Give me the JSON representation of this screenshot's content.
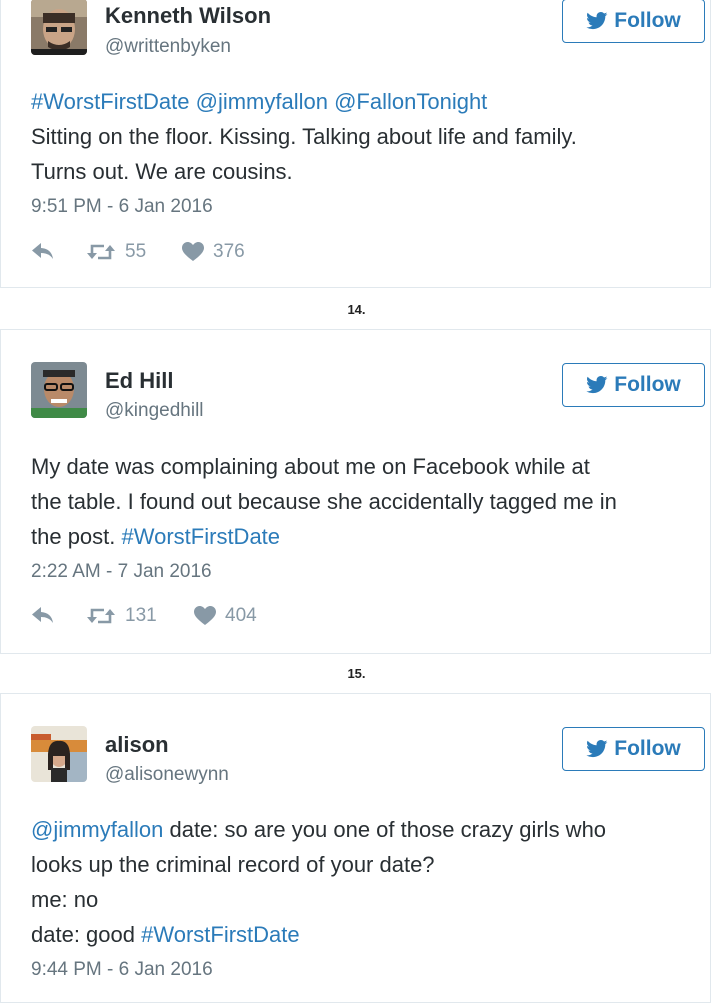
{
  "tweets": [
    {
      "name": "Kenneth Wilson",
      "handle": "@writtenbyken",
      "follow_label": "Follow",
      "body": {
        "l1a": "#WorstFirstDate @jimmyfallon @FallonTonight",
        "l2": "Sitting on the floor. Kissing. Talking about life and family.",
        "l3": "Turns out. We are cousins."
      },
      "timestamp": "9:51 PM - 6 Jan 2016",
      "retweets": "55",
      "likes": "376"
    },
    {
      "name": "Ed Hill",
      "handle": "@kingedhill",
      "follow_label": "Follow",
      "body": {
        "l1": "My date was complaining about me on Facebook while at",
        "l2": "the table. I found out because she accidentally tagged me in",
        "l3a": "the post. ",
        "l3b": "#WorstFirstDate"
      },
      "timestamp": "2:22 AM - 7 Jan 2016",
      "retweets": "131",
      "likes": "404"
    },
    {
      "name": "alison",
      "handle": "@alisonewynn",
      "follow_label": "Follow",
      "body": {
        "l1a": "@jimmyfallon",
        "l1b": " date: so are you one of those crazy girls who",
        "l2": "looks up the criminal record of your date?",
        "l3": "me: no",
        "l4a": "date: good ",
        "l4b": "#WorstFirstDate"
      },
      "timestamp": "9:44 PM - 6 Jan 2016"
    }
  ],
  "numbering": [
    "14.",
    "15."
  ],
  "colors": {
    "link": "#2b7bb9",
    "text": "#292f33",
    "meta": "#66757f",
    "border": "#e1e8ed"
  },
  "icons": [
    "reply-icon",
    "retweet-icon",
    "heart-icon",
    "twitter-bird-icon"
  ]
}
